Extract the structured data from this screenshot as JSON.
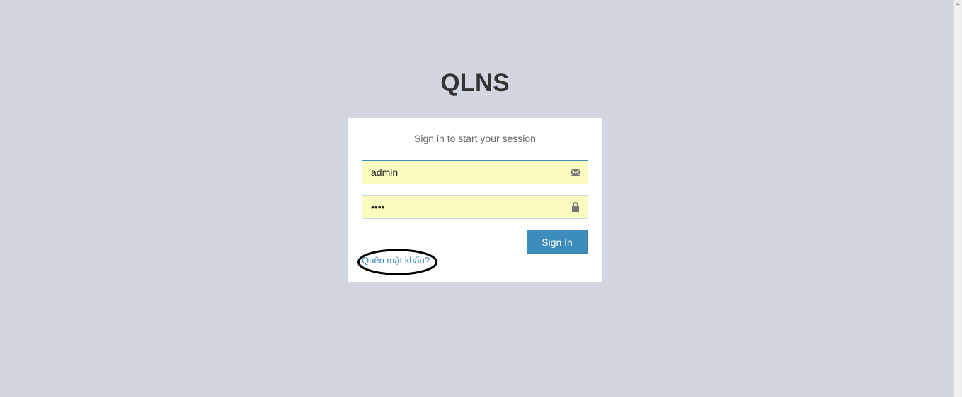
{
  "logo": {
    "text": "QLNS"
  },
  "login": {
    "message": "Sign in to start your session",
    "username": {
      "value": "admin",
      "icon": "envelope-icon"
    },
    "password": {
      "masked_value": "••••",
      "icon": "lock-icon"
    },
    "submit_label": "Sign In",
    "forgot_label": "Quên mật khẩu?"
  },
  "colors": {
    "background": "#d2d6de",
    "primary": "#3c8dbc",
    "autofill": "#fafdbf"
  }
}
